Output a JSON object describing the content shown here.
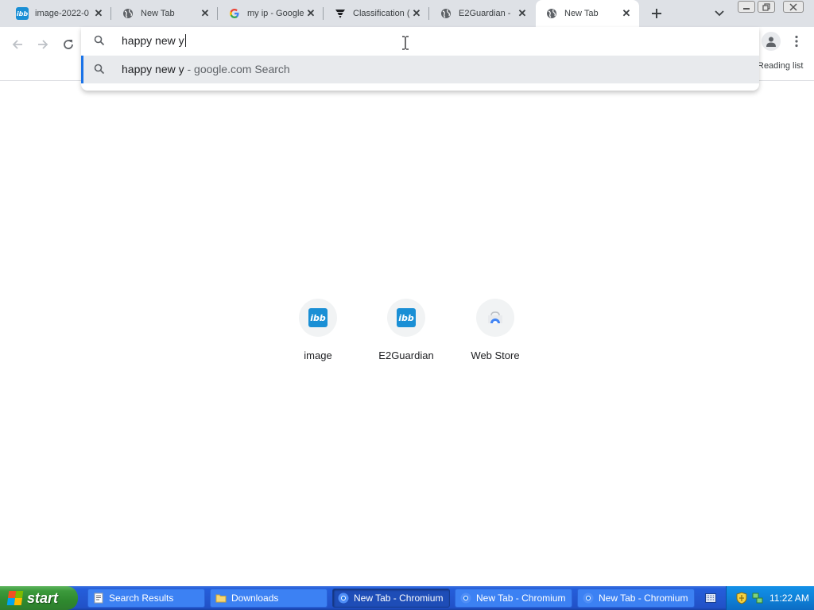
{
  "tabs": [
    {
      "title": "image-2022-0",
      "icon": "ibb-icon",
      "active": false
    },
    {
      "title": "New Tab",
      "icon": "globe-icon",
      "active": false
    },
    {
      "title": "my ip - Google",
      "icon": "google-icon",
      "active": false
    },
    {
      "title": "Classification (",
      "icon": "filter-icon",
      "active": false
    },
    {
      "title": "E2Guardian - ",
      "icon": "globe-icon",
      "active": false
    },
    {
      "title": "New Tab",
      "icon": "globe-icon",
      "active": true
    }
  ],
  "toolbar": {
    "reading_list_label": "Reading list"
  },
  "omnibox": {
    "value": "happy new y",
    "suggestion_query": "happy new y",
    "suggestion_description": " - google.com Search"
  },
  "shortcuts": [
    {
      "label": "image",
      "icon": "ibb-icon"
    },
    {
      "label": "E2Guardian",
      "icon": "ibb-icon"
    },
    {
      "label": "Web Store",
      "icon": "webstore-icon"
    }
  ],
  "ibb_logo_text": "ibb",
  "taskbar": {
    "start_label": "start",
    "tasks": [
      {
        "label": "Search Results",
        "icon": "search-results-icon",
        "active": false
      },
      {
        "label": "Downloads",
        "icon": "folder-icon",
        "active": false
      },
      {
        "label": "New Tab - Chromium",
        "icon": "chromium-icon",
        "active": true
      },
      {
        "label": "New Tab - Chromium",
        "icon": "chromium-icon",
        "active": false
      },
      {
        "label": "New Tab - Chromium",
        "icon": "chromium-icon",
        "active": false
      }
    ],
    "clock": "11:22 AM"
  },
  "colors": {
    "tabstrip_bg": "#dee1e6",
    "accent_blue": "#1a73e8",
    "taskbar_blue": "#245edb",
    "start_green": "#3c9a3c"
  }
}
